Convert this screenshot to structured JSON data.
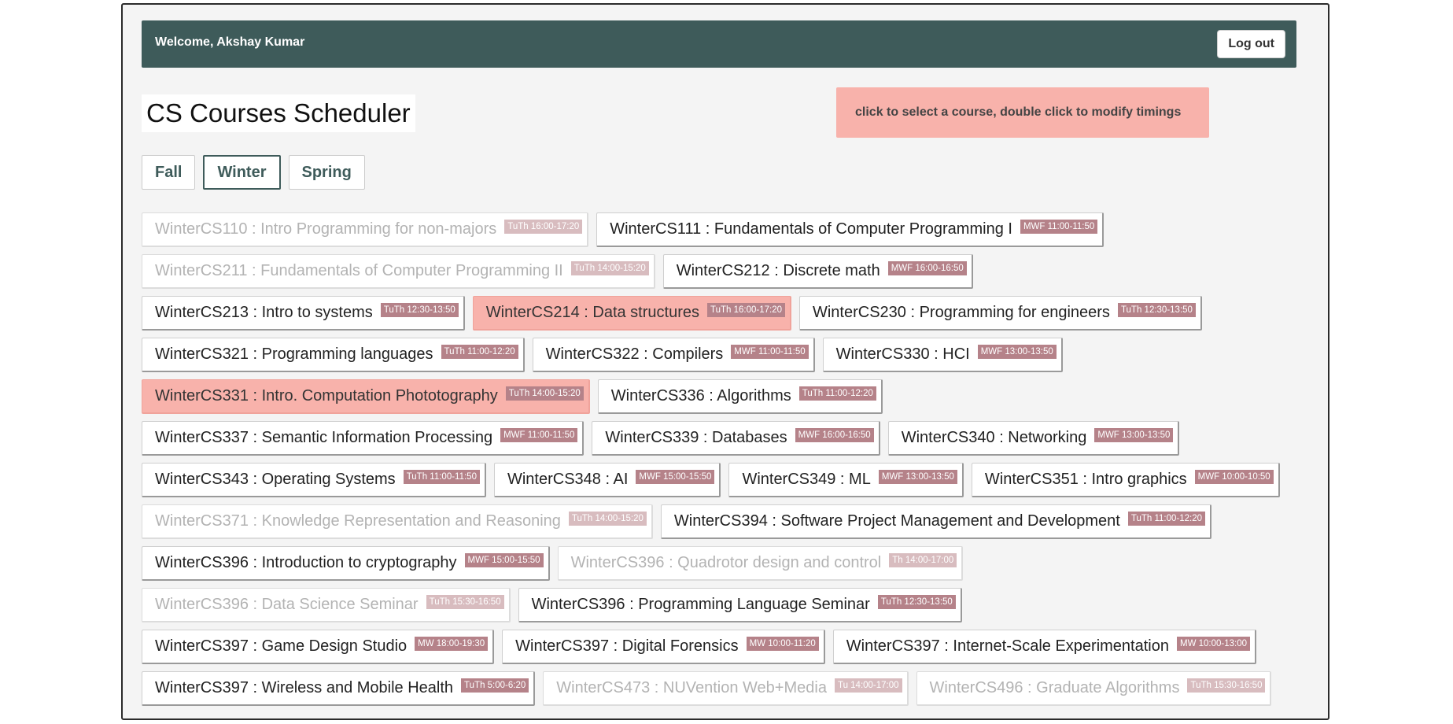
{
  "header": {
    "welcome": "Welcome, Akshay Kumar",
    "logout_label": "Log out"
  },
  "page_title": "CS Courses Scheduler",
  "hint": "click to select a course, double click to modify timings",
  "terms": [
    {
      "label": "Fall",
      "active": false
    },
    {
      "label": "Winter",
      "active": true
    },
    {
      "label": "Spring",
      "active": false
    }
  ],
  "colors": {
    "header": "#3e5b5a",
    "selected": "#f8b2ab",
    "time_badge": "#b58289"
  },
  "courses": [
    {
      "name": "WinterCS110 : Intro Programming for non-majors",
      "time": "TuTh 16:00-17:20",
      "state": "disabled"
    },
    {
      "name": "WinterCS111 : Fundamentals of Computer Programming I",
      "time": "MWF 11:00-11:50",
      "state": "normal"
    },
    {
      "name": "WinterCS211 : Fundamentals of Computer Programming II",
      "time": "TuTh 14:00-15:20",
      "state": "disabled"
    },
    {
      "name": "WinterCS212 : Discrete math",
      "time": "MWF 16:00-16:50",
      "state": "normal"
    },
    {
      "name": "WinterCS213 : Intro to systems",
      "time": "TuTh 12:30-13:50",
      "state": "normal"
    },
    {
      "name": "WinterCS214 : Data structures",
      "time": "TuTh 16:00-17:20",
      "state": "selected"
    },
    {
      "name": "WinterCS230 : Programming for engineers",
      "time": "TuTh 12:30-13:50",
      "state": "normal"
    },
    {
      "name": "WinterCS321 : Programming languages",
      "time": "TuTh 11:00-12:20",
      "state": "normal"
    },
    {
      "name": "WinterCS322 : Compilers",
      "time": "MWF 11:00-11:50",
      "state": "normal"
    },
    {
      "name": "WinterCS330 : HCI",
      "time": "MWF 13:00-13:50",
      "state": "normal"
    },
    {
      "name": "WinterCS331 : Intro. Computation Phototography",
      "time": "TuTh 14:00-15:20",
      "state": "selected"
    },
    {
      "name": "WinterCS336 : Algorithms",
      "time": "TuTh 11:00-12:20",
      "state": "normal"
    },
    {
      "name": "WinterCS337 : Semantic Information Processing",
      "time": "MWF 11:00-11:50",
      "state": "normal"
    },
    {
      "name": "WinterCS339 : Databases",
      "time": "MWF 16:00-16:50",
      "state": "normal"
    },
    {
      "name": "WinterCS340 : Networking",
      "time": "MWF 13:00-13:50",
      "state": "normal"
    },
    {
      "name": "WinterCS343 : Operating Systems",
      "time": "TuTh 11:00-11:50",
      "state": "normal"
    },
    {
      "name": "WinterCS348 : AI",
      "time": "MWF 15:00-15:50",
      "state": "normal"
    },
    {
      "name": "WinterCS349 : ML",
      "time": "MWF 13:00-13:50",
      "state": "normal"
    },
    {
      "name": "WinterCS351 : Intro graphics",
      "time": "MWF 10:00-10:50",
      "state": "normal"
    },
    {
      "name": "WinterCS371 : Knowledge Representation and Reasoning",
      "time": "TuTh 14:00-15:20",
      "state": "disabled"
    },
    {
      "name": "WinterCS394 : Software Project Management and Development",
      "time": "TuTh 11:00-12:20",
      "state": "normal"
    },
    {
      "name": "WinterCS396 : Introduction to cryptography",
      "time": "MWF 15:00-15:50",
      "state": "normal"
    },
    {
      "name": "WinterCS396 : Quadrotor design and control",
      "time": "Th 14:00-17:00",
      "state": "disabled"
    },
    {
      "name": "WinterCS396 : Data Science Seminar",
      "time": "TuTh 15:30-16:50",
      "state": "disabled"
    },
    {
      "name": "WinterCS396 : Programming Language Seminar",
      "time": "TuTh 12:30-13:50",
      "state": "normal"
    },
    {
      "name": "WinterCS397 : Game Design Studio",
      "time": "MW 18:00-19:30",
      "state": "normal"
    },
    {
      "name": "WinterCS397 : Digital Forensics",
      "time": "MW 10:00-11:20",
      "state": "normal"
    },
    {
      "name": "WinterCS397 : Internet-Scale Experimentation",
      "time": "MW 10:00-13:00",
      "state": "normal"
    },
    {
      "name": "WinterCS397 : Wireless and Mobile Health",
      "time": "TuTh 5:00-6:20",
      "state": "normal"
    },
    {
      "name": "WinterCS473 : NUVention Web+Media",
      "time": "Tu 14:00-17:00",
      "state": "disabled"
    },
    {
      "name": "WinterCS496 : Graduate Algorithms",
      "time": "TuTh 15:30-16:50",
      "state": "disabled"
    }
  ]
}
